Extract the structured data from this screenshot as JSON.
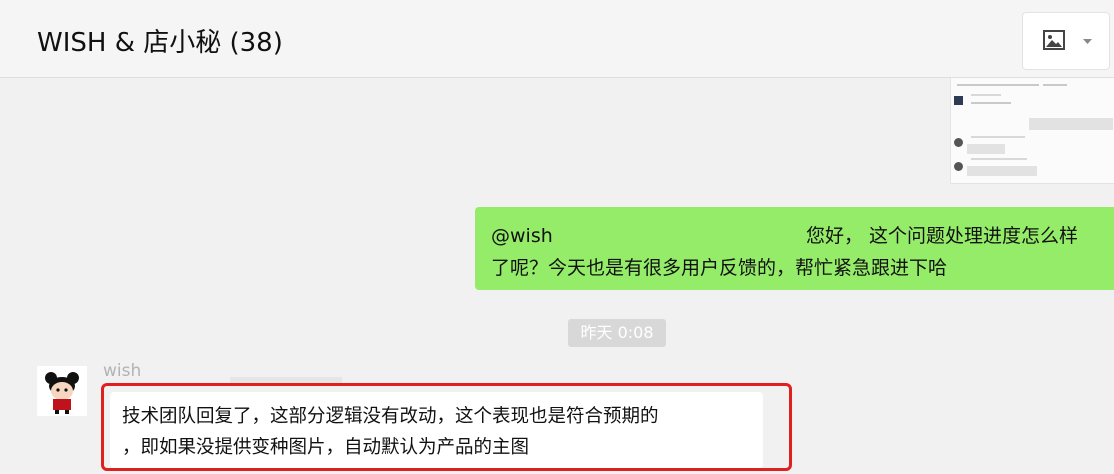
{
  "header": {
    "title": "WISH & 店小秘 (38)"
  },
  "toolbar": {
    "image_icon": "image-icon",
    "dropdown_icon": "caret-down-icon"
  },
  "messages": {
    "outgoing": {
      "mention": "@wish",
      "text_line1": "您好， 这个问题处理进度怎么样",
      "text_line2": "了呢？今天也是有很多用户反馈的，帮忙紧急跟进下哈",
      "color": "#95ec69"
    },
    "timestamp": "昨天 0:08",
    "incoming": {
      "sender": "wish",
      "line1": "技术团队回复了，这部分逻辑没有改动，这个表现也是符合预期的",
      "line2": "，即如果没提供变种图片，自动默认为产品的主图",
      "highlight_color": "#e01f1f"
    }
  }
}
